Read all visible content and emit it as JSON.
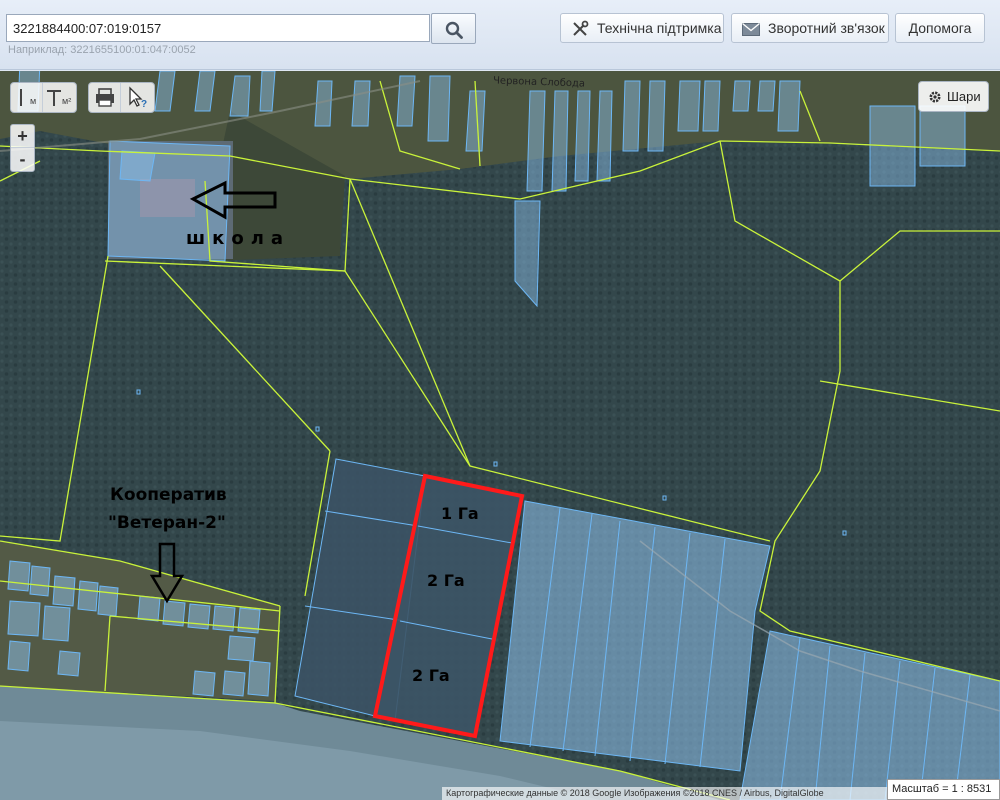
{
  "search": {
    "value": "3221884400:07:019:0157",
    "hint": "Наприклад: 3221655100:01:047:0052"
  },
  "header_buttons": {
    "support": "Технічна підтримка",
    "feedback": "Зворотний зв'язок",
    "help": "Допомога"
  },
  "tools": {
    "measure_length_sub": "м",
    "measure_area_sub": "м²"
  },
  "zoom": {
    "in": "+",
    "out": "-"
  },
  "layers": {
    "label": "Шари"
  },
  "map_labels": {
    "street": "Червона Слобода",
    "school": "школа",
    "coop_line1": "Кооператив",
    "coop_line2": "\"Ветеран-2\"",
    "area1": "1 Га",
    "area2": "2 Га",
    "area3": "2 Га"
  },
  "attribution": "Картографические данные © 2018 Google Изображения ©2018 CNES / Airbus, DigitalGlobe",
  "scale": "Масштаб = 1 : 8531",
  "colors": {
    "parcel_fill": "#8fc3ef",
    "parcel_stroke": "#6db7f5",
    "boundary": "#c9f23a",
    "highlight": "#ff1a1a",
    "forest": "#34484c"
  }
}
